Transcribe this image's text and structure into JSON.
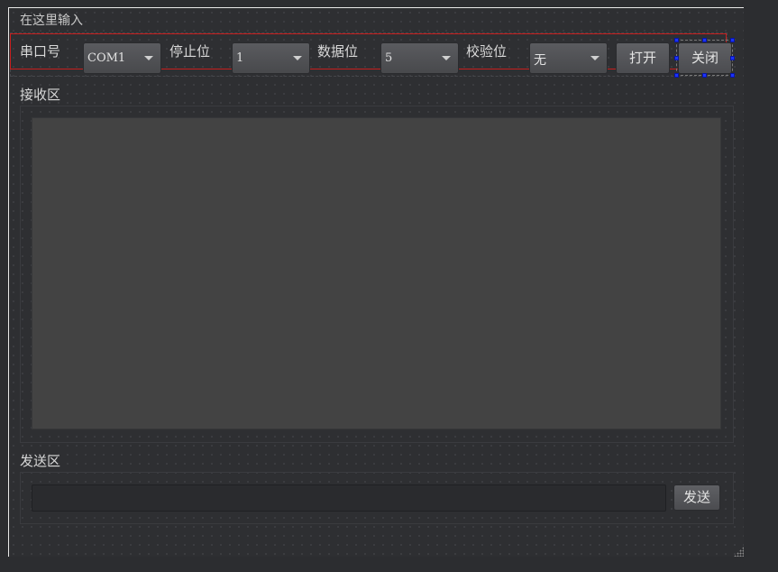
{
  "window": {
    "title": "在这里输入"
  },
  "toolbar": {
    "port_label": "串口号",
    "port_value": "COM1",
    "stopbits_label": "停止位",
    "stopbits_value": "1",
    "databits_label": "数据位",
    "databits_value": "5",
    "parity_label": "校验位",
    "parity_value": "无",
    "open_label": "打开",
    "close_label": "关闭"
  },
  "receive": {
    "label": "接收区",
    "text": ""
  },
  "send": {
    "label": "发送区",
    "value": "",
    "send_label": "发送"
  },
  "colors": {
    "background": "#2c2d30",
    "text_area": "#434343",
    "layout_border": "#c81e1e",
    "selection_handle": "#1a33ff"
  }
}
